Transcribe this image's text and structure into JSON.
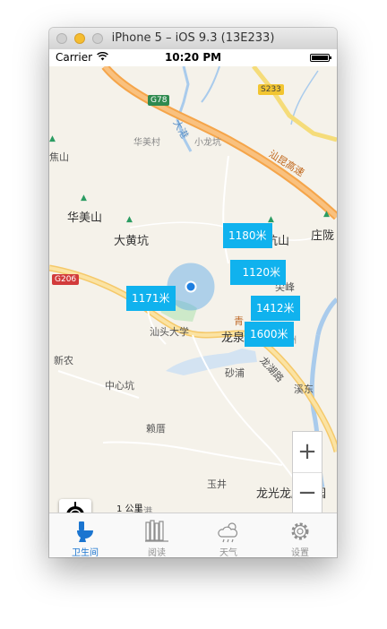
{
  "window": {
    "title": "iPhone 5 – iOS 9.3 (13E233)"
  },
  "status": {
    "carrier": "Carrier",
    "time": "10:20 PM"
  },
  "map": {
    "road_labels": [
      {
        "text": "G78",
        "kind": "green"
      },
      {
        "text": "S233",
        "kind": "yellow"
      },
      {
        "text": "G206",
        "kind": "red"
      }
    ],
    "roads": [
      "汕昆高速",
      "大港",
      "龙湖路",
      "汕头大学"
    ],
    "places": [
      "华美村",
      "小龙坑",
      "焦山",
      "华美山",
      "大黄坑",
      "坑山",
      "庄陇",
      "尖峰",
      "龙泉",
      "青",
      "新农",
      "中心坑",
      "砂浦",
      "溪东",
      "赖厝",
      "玉井",
      "龙光龙腾嘉园",
      "天港",
      "洲"
    ],
    "distance_markers": [
      "1180米",
      "1120米",
      "1171米",
      "1412米",
      "1600米"
    ],
    "scale": "1 公里",
    "zoom_in": "+",
    "zoom_out": "−"
  },
  "tabs": [
    {
      "label": "卫生间",
      "icon": "toilet-icon",
      "active": true
    },
    {
      "label": "阅读",
      "icon": "books-icon",
      "active": false
    },
    {
      "label": "天气",
      "icon": "weather-icon",
      "active": false
    },
    {
      "label": "设置",
      "icon": "gear-icon",
      "active": false
    }
  ],
  "colors": {
    "accent": "#1b75d0",
    "marker": "#10b2ee",
    "highway": "#f5a54a",
    "water": "#a9cbec"
  }
}
